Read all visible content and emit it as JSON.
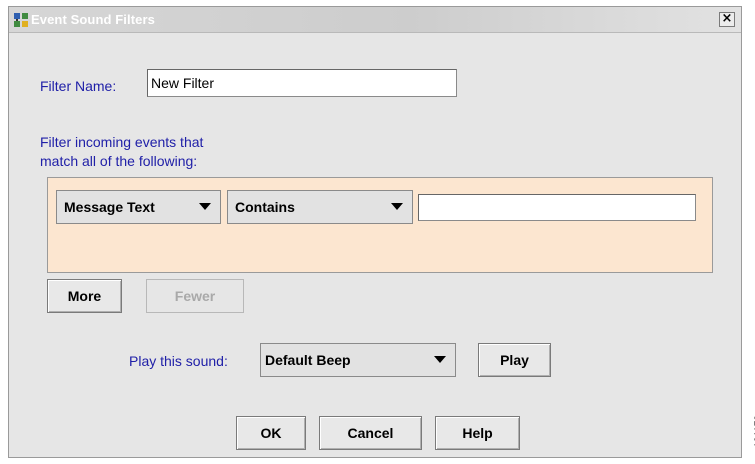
{
  "window": {
    "title": "Event Sound Filters",
    "close_label": "×"
  },
  "filter_name": {
    "label": "Filter Name:",
    "value": "New Filter"
  },
  "criteria": {
    "heading_line1": "Filter incoming events that",
    "heading_line2": "match all of the following:",
    "field_select": "Message Text",
    "operator_select": "Contains",
    "value": ""
  },
  "row_buttons": {
    "more": "More",
    "fewer": "Fewer"
  },
  "sound": {
    "label": "Play this sound:",
    "selected": "Default Beep",
    "play": "Play"
  },
  "footer": {
    "ok": "OK",
    "cancel": "Cancel",
    "help": "Help"
  },
  "side_code": "101170"
}
